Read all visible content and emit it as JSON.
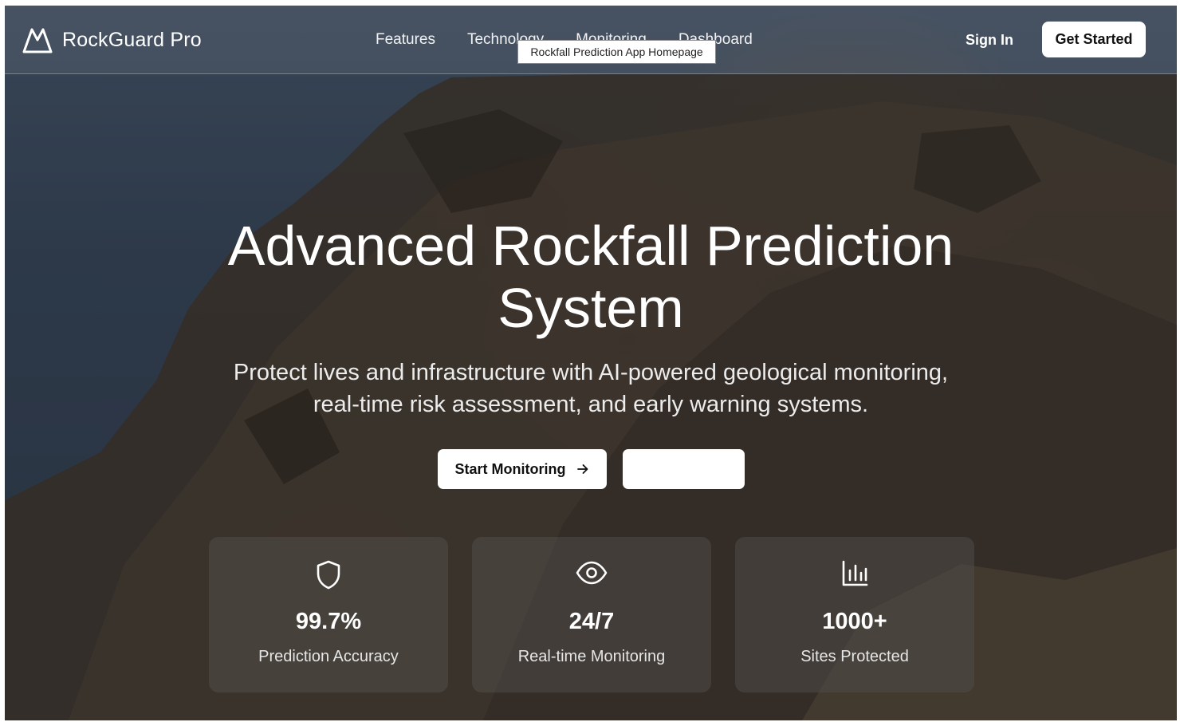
{
  "brand": {
    "name": "RockGuard Pro",
    "icon": "mountain-icon"
  },
  "nav": {
    "links": [
      "Features",
      "Technology",
      "Monitoring",
      "Dashboard"
    ],
    "sign_in": "Sign In",
    "get_started": "Get Started"
  },
  "tooltip": "Rockfall Prediction App Homepage",
  "hero": {
    "title_line1": "Advanced Rockfall Prediction",
    "title_line2": "System",
    "subtitle_line1": "Protect lives and infrastructure with AI-powered geological monitoring,",
    "subtitle_line2": "real-time risk assessment, and early warning systems.",
    "primary_button": "Start Monitoring",
    "primary_button_icon": "arrow-right-icon",
    "secondary_button": ""
  },
  "stats": [
    {
      "icon": "shield-icon",
      "value": "99.7%",
      "label": "Prediction Accuracy"
    },
    {
      "icon": "eye-icon",
      "value": "24/7",
      "label": "Real-time Monitoring"
    },
    {
      "icon": "bar-chart-icon",
      "value": "1000+",
      "label": "Sites Protected"
    }
  ],
  "colors": {
    "button_bg": "#ffffff",
    "text": "#ffffff"
  }
}
